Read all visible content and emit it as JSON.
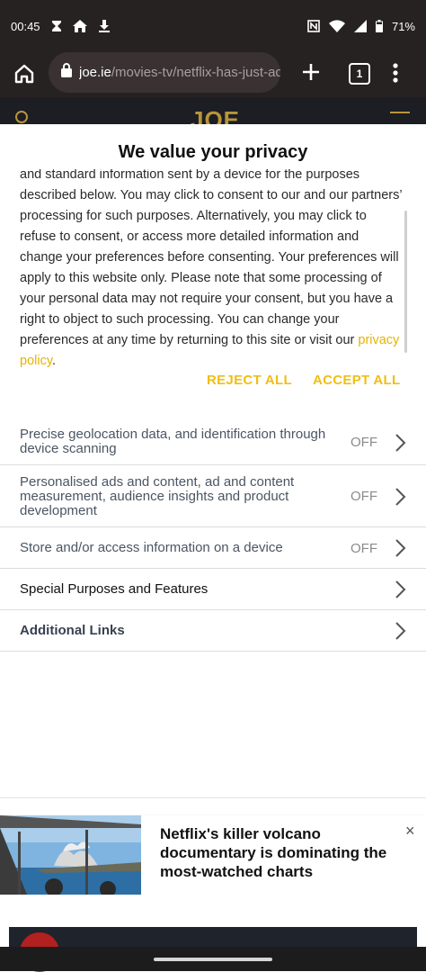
{
  "status_bar": {
    "time": "00:45",
    "battery": "71%",
    "icons": [
      "hourglass-icon",
      "home-icon",
      "download-icon",
      "nfc-icon",
      "wifi-icon",
      "signal-icon",
      "battery-icon"
    ]
  },
  "browser": {
    "url_domain": "joe.ie",
    "url_path": "/movies-tv/netflix-has-just-ac",
    "tab_count": "1",
    "site_logo": "JOE"
  },
  "consent": {
    "title": "We value your privacy",
    "body_text": "and standard information sent by a device for the purposes described below. You may click to consent to our and our partners’ processing for such purposes. Alternatively, you may click to refuse to consent, or access more detailed information and change your preferences before consenting. Your preferences will apply to this website only. Please note that some processing of your personal data may not require your consent, but you have a right to object to such processing. You can change your preferences at any time by returning to this site or visit our ",
    "privacy_link": "privacy policy",
    "period": ".",
    "reject_label": "REJECT ALL",
    "accept_label": "ACCEPT ALL",
    "link_color": "#e5b400",
    "purposes": [
      {
        "label": "Precise geolocation data, and identification through device scanning",
        "state": "OFF"
      },
      {
        "label": "Personalised ads and content, ad and content measurement, audience insights and product development",
        "state": "OFF"
      },
      {
        "label": "Store and/or access information on a device",
        "state": "OFF"
      },
      {
        "label": "Special Purposes and Features",
        "state": ""
      },
      {
        "label": "Additional Links",
        "state": ""
      }
    ]
  },
  "ad": {
    "headline": "Netflix's killer volcano documentary is dominating the most-watched charts",
    "close": "×"
  }
}
